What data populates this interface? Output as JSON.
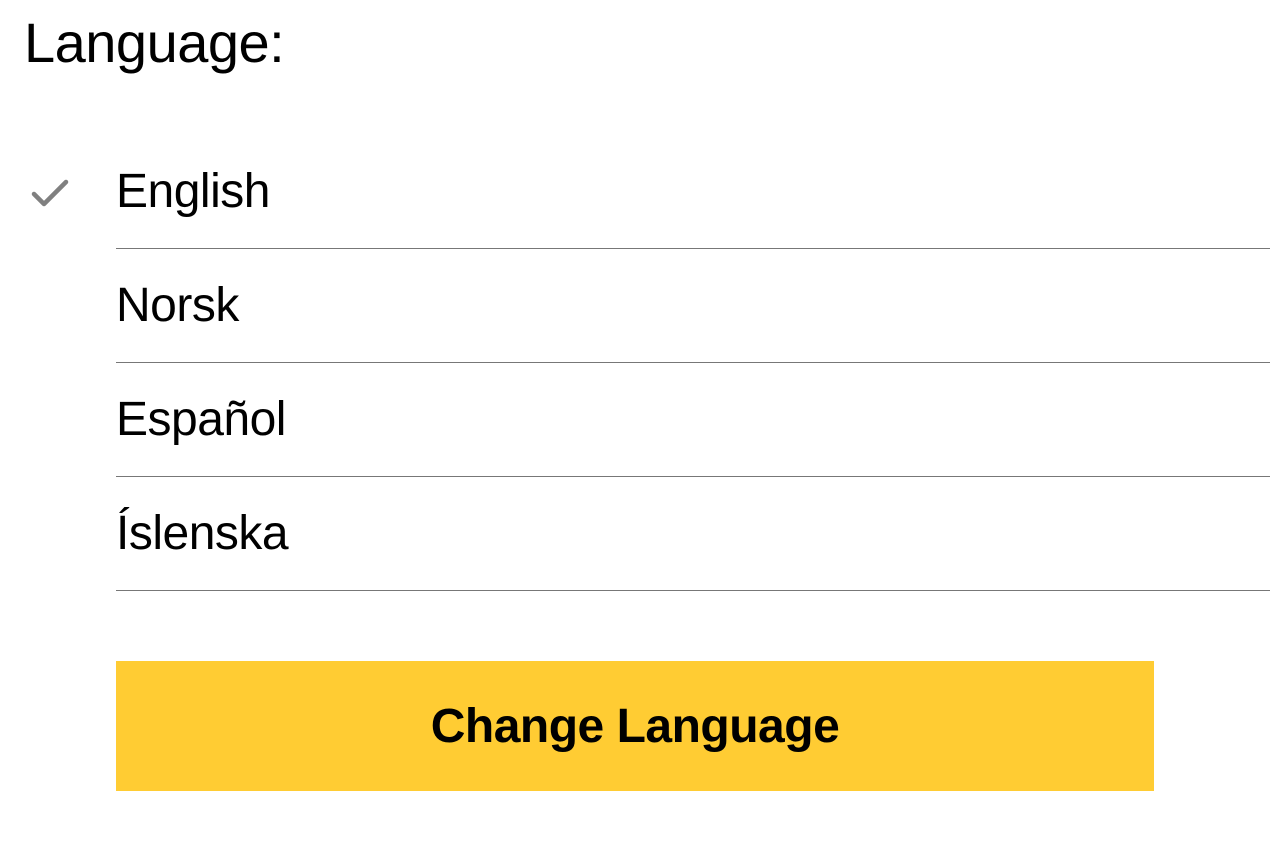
{
  "heading": "Language:",
  "selected_index": 0,
  "languages": [
    {
      "label": "English"
    },
    {
      "label": "Norsk"
    },
    {
      "label": "Español"
    },
    {
      "label": "Íslenska"
    }
  ],
  "button_label": "Change Language",
  "colors": {
    "accent": "#FFCC33",
    "check": "#808080",
    "divider": "#777777"
  }
}
